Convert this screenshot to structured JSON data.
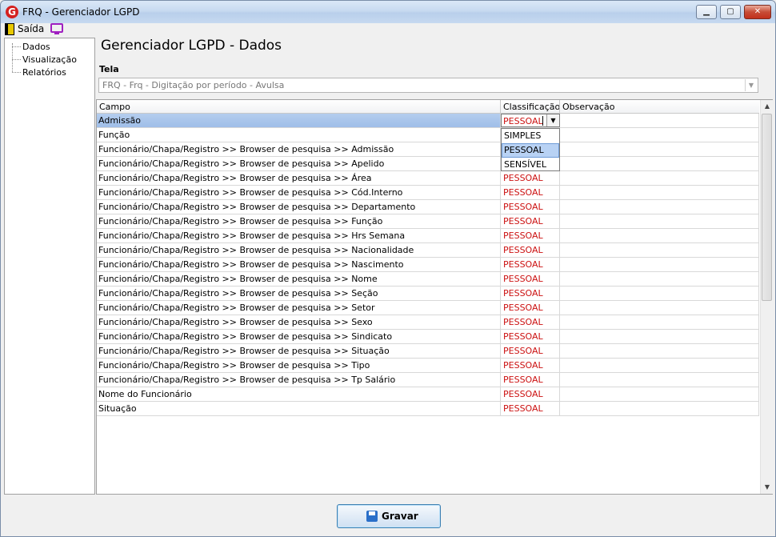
{
  "window": {
    "title": "FRQ - Gerenciador LGPD",
    "logo_letter": "G",
    "min": "▁",
    "max": "▢",
    "close": "✕"
  },
  "menubar": {
    "exit_label": "Saída"
  },
  "sidebar": {
    "items": [
      {
        "label": "Dados"
      },
      {
        "label": "Visualização"
      },
      {
        "label": "Relatórios"
      }
    ]
  },
  "page": {
    "title": "Gerenciador LGPD - Dados"
  },
  "tela": {
    "label": "Tela",
    "value": "FRQ - Frq - Digitação por período - Avulsa"
  },
  "grid": {
    "columns": {
      "campo": "Campo",
      "classificacao": "Classificação",
      "observacao": "Observação"
    },
    "editor_value": "PESSOAL",
    "dropdown_options": [
      "SIMPLES",
      "PESSOAL",
      "SENSÍVEL"
    ],
    "dropdown_highlighted": "PESSOAL",
    "rows": [
      {
        "campo": "Admissão",
        "classificacao": "PESSOAL",
        "observacao": ""
      },
      {
        "campo": "Função",
        "classificacao": "",
        "observacao": ""
      },
      {
        "campo": "Funcionário/Chapa/Registro >> Browser de pesquisa >> Admissão",
        "classificacao": "",
        "observacao": ""
      },
      {
        "campo": "Funcionário/Chapa/Registro >> Browser de pesquisa >> Apelido",
        "classificacao": "",
        "observacao": ""
      },
      {
        "campo": "Funcionário/Chapa/Registro >> Browser de pesquisa >> Área",
        "classificacao": "PESSOAL",
        "observacao": ""
      },
      {
        "campo": "Funcionário/Chapa/Registro >> Browser de pesquisa >> Cód.Interno",
        "classificacao": "PESSOAL",
        "observacao": ""
      },
      {
        "campo": "Funcionário/Chapa/Registro >> Browser de pesquisa >> Departamento",
        "classificacao": "PESSOAL",
        "observacao": ""
      },
      {
        "campo": "Funcionário/Chapa/Registro >> Browser de pesquisa >> Função",
        "classificacao": "PESSOAL",
        "observacao": ""
      },
      {
        "campo": "Funcionário/Chapa/Registro >> Browser de pesquisa >> Hrs Semana",
        "classificacao": "PESSOAL",
        "observacao": ""
      },
      {
        "campo": "Funcionário/Chapa/Registro >> Browser de pesquisa >> Nacionalidade",
        "classificacao": "PESSOAL",
        "observacao": ""
      },
      {
        "campo": "Funcionário/Chapa/Registro >> Browser de pesquisa >> Nascimento",
        "classificacao": "PESSOAL",
        "observacao": ""
      },
      {
        "campo": "Funcionário/Chapa/Registro >> Browser de pesquisa >> Nome",
        "classificacao": "PESSOAL",
        "observacao": ""
      },
      {
        "campo": "Funcionário/Chapa/Registro >> Browser de pesquisa >> Seção",
        "classificacao": "PESSOAL",
        "observacao": ""
      },
      {
        "campo": "Funcionário/Chapa/Registro >> Browser de pesquisa >> Setor",
        "classificacao": "PESSOAL",
        "observacao": ""
      },
      {
        "campo": "Funcionário/Chapa/Registro >> Browser de pesquisa >> Sexo",
        "classificacao": "PESSOAL",
        "observacao": ""
      },
      {
        "campo": "Funcionário/Chapa/Registro >> Browser de pesquisa >> Sindicato",
        "classificacao": "PESSOAL",
        "observacao": ""
      },
      {
        "campo": "Funcionário/Chapa/Registro >> Browser de pesquisa >> Situação",
        "classificacao": "PESSOAL",
        "observacao": ""
      },
      {
        "campo": "Funcionário/Chapa/Registro >> Browser de pesquisa >> Tipo",
        "classificacao": "PESSOAL",
        "observacao": ""
      },
      {
        "campo": "Funcionário/Chapa/Registro >> Browser de pesquisa >> Tp Salário",
        "classificacao": "PESSOAL",
        "observacao": ""
      },
      {
        "campo": "Nome do Funcionário",
        "classificacao": "PESSOAL",
        "observacao": ""
      },
      {
        "campo": "Situação",
        "classificacao": "PESSOAL",
        "observacao": ""
      }
    ]
  },
  "footer": {
    "save_label": "Gravar"
  },
  "colors": {
    "classification_text": "#cc1111",
    "selected_row": "#a9c6ec"
  }
}
